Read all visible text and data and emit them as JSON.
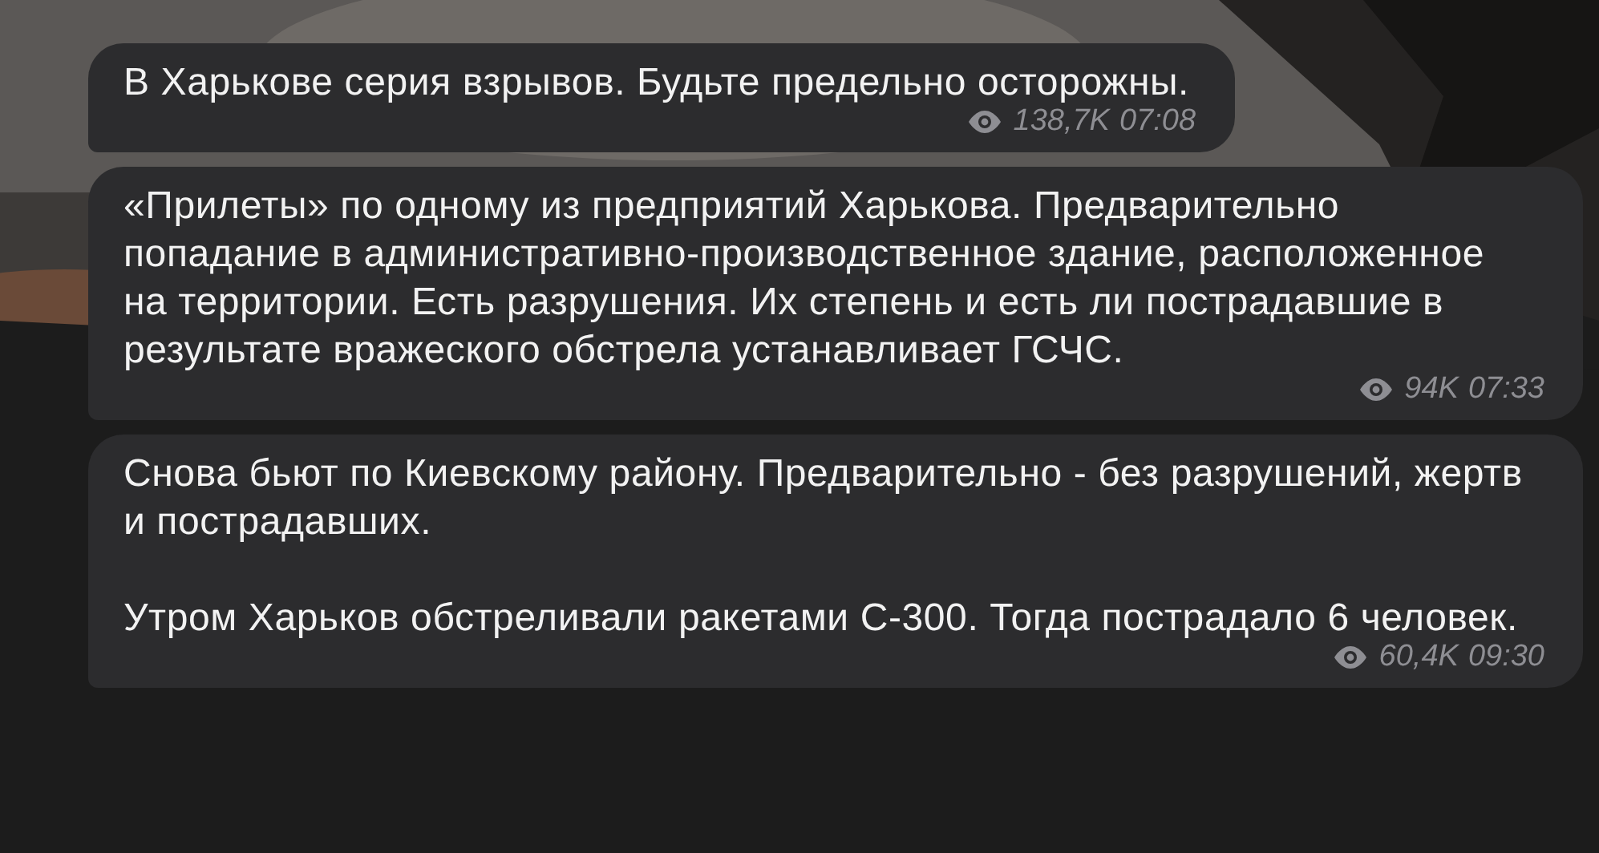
{
  "messages": [
    {
      "paragraphs": [
        "В Харькове серия взрывов. Будьте предельно осторожны."
      ],
      "views": "138,7K",
      "time": "07:08"
    },
    {
      "paragraphs": [
        "«Прилеты» по одному из предприятий Харькова. Предварительно попадание в административно-производственное здание, расположенное на территории. Есть разрушения. Их степень и есть ли пострадавшие в результате вражеского обстрела устанавливает ГСЧС."
      ],
      "views": "94K",
      "time": "07:33"
    },
    {
      "paragraphs": [
        "Снова бьют по Киевскому району. Предварительно - без разрушений, жертв и пострадавших.",
        "Утром Харьков обстреливали ракетами С-300. Тогда пострадало 6 человек."
      ],
      "views": "60,4K",
      "time": "09:30"
    }
  ]
}
